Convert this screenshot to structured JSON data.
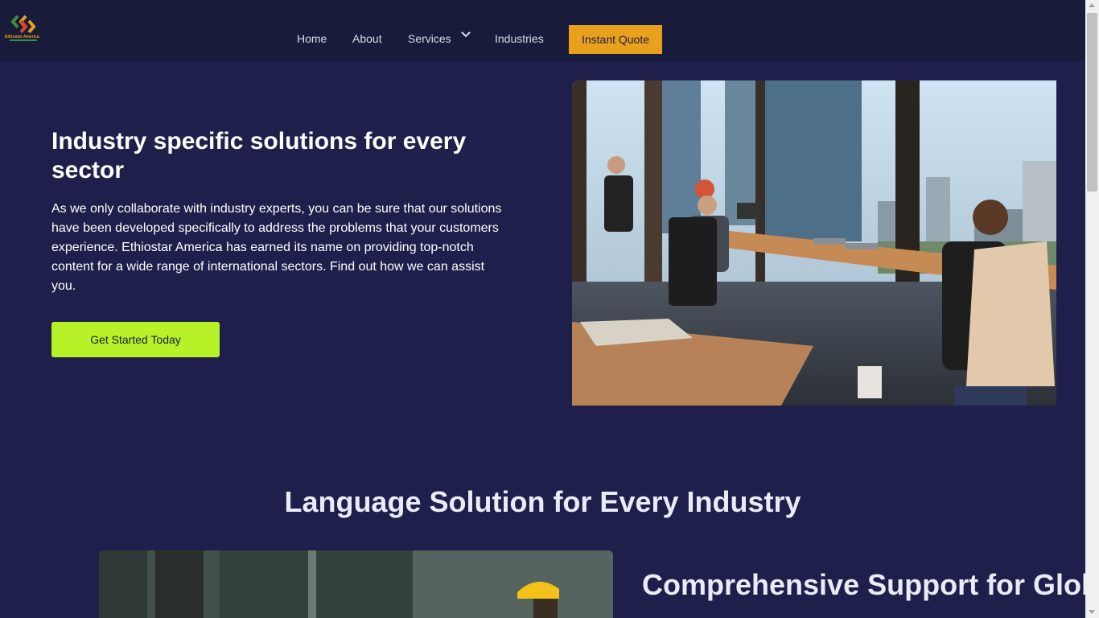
{
  "brand": {
    "name": "Ethiostar America",
    "logo_icon": "double-chevron-logo",
    "colors": {
      "orange": "#e9a01d",
      "green": "#3b8d3b",
      "red": "#d9442b"
    }
  },
  "nav": {
    "home": "Home",
    "about": "About",
    "services": "Services",
    "industries": "Industries",
    "instant_quote": "Instant Quote",
    "services_caret_icon": "chevron-down-icon"
  },
  "hero": {
    "title": "Industry specific solutions for every sector",
    "text": "As we only collaborate with industry experts, you can be sure that our solutions have been developed specifically to address the problems that your customers experience. Ethiostar America has earned its name on providing top-notch content for a wide range of international sectors. Find out how we can assist you.",
    "cta": "Get Started Today",
    "image_subject": "office-team-photo"
  },
  "section": {
    "title": "Language Solution for Every Industry",
    "support_title": "Comprehensive Support for Global",
    "image_subject": "construction-worker-photo"
  },
  "colors": {
    "page_bg": "#1e1f4b",
    "header_bg": "#181c3a",
    "quote_button": "#e9a01d",
    "cta_button": "#b6f227",
    "heading": "#ffffff"
  }
}
